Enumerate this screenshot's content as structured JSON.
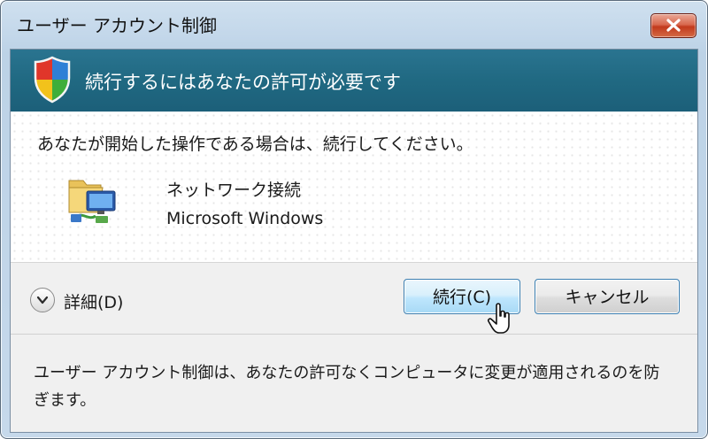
{
  "window": {
    "title": "ユーザー アカウント制御"
  },
  "banner": {
    "text": "続行するにはあなたの許可が必要です"
  },
  "content": {
    "instruction": "あなたが開始した操作である場合は、続行してください。",
    "program_name": "ネットワーク接続",
    "publisher": "Microsoft Windows"
  },
  "actions": {
    "details_label": "詳細(D)",
    "continue_label": "続行(C)",
    "cancel_label": "キャンセル"
  },
  "footer": {
    "text": "ユーザー アカウント制御は、あなたの許可なくコンピュータに変更が適用されるのを防ぎます。"
  },
  "icons": {
    "close": "close-icon",
    "shield": "uac-shield-icon",
    "program": "network-connections-icon",
    "details": "chevron-down-icon",
    "cursor": "mouse-cursor-icon"
  },
  "colors": {
    "banner": "#206982",
    "continue_button": "#bee6fd",
    "close_button": "#c23a1d"
  }
}
